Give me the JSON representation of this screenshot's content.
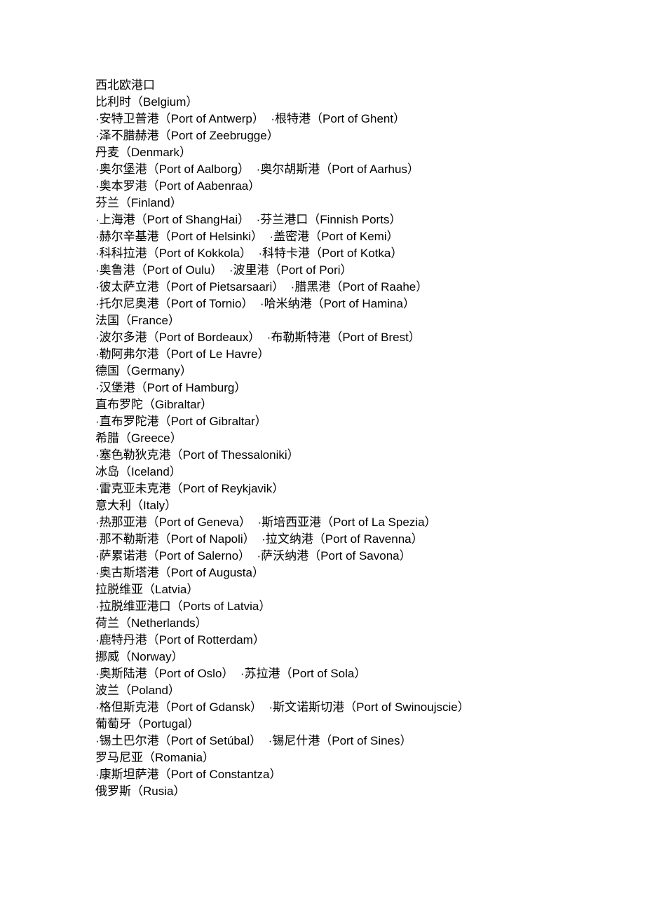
{
  "document": {
    "title": "西北欧港口",
    "lines": [
      {
        "kind": "heading",
        "text": "西北欧港口"
      },
      {
        "kind": "country",
        "text": "比利时（Belgium）"
      },
      {
        "kind": "ports",
        "text": "·安特卫普港（Port of Antwerp）  ·根特港（Port of Ghent）"
      },
      {
        "kind": "ports",
        "text": "·泽不腊赫港（Port of Zeebrugge）"
      },
      {
        "kind": "country",
        "text": "丹麦（Denmark）"
      },
      {
        "kind": "ports",
        "text": "·奥尔堡港（Port of Aalborg）  ·奥尔胡斯港（Port of Aarhus）"
      },
      {
        "kind": "ports",
        "text": "·奥本罗港（Port of Aabenraa）"
      },
      {
        "kind": "country",
        "text": "芬兰（Finland）"
      },
      {
        "kind": "ports",
        "text": "·上海港（Port of ShangHai）  ·芬兰港口（Finnish Ports）"
      },
      {
        "kind": "ports",
        "text": "·赫尔辛基港（Port of Helsinki）  ·盖密港（Port of Kemi）"
      },
      {
        "kind": "ports",
        "text": "·科科拉港（Port of Kokkola）  ·科特卡港（Port of Kotka）"
      },
      {
        "kind": "ports",
        "text": "·奥鲁港（Port of Oulu）  ·波里港（Port of Pori）"
      },
      {
        "kind": "ports",
        "text": "·彼太萨立港（Port of Pietsarsaari）  ·腊黑港（Port of Raahe）"
      },
      {
        "kind": "ports",
        "text": "·托尔尼奥港（Port of Tornio）  ·哈米纳港（Port of Hamina）"
      },
      {
        "kind": "country",
        "text": "法国（France）"
      },
      {
        "kind": "ports",
        "text": "·波尔多港（Port of Bordeaux）  ·布勒斯特港（Port of Brest）"
      },
      {
        "kind": "ports",
        "text": "·勒阿弗尔港（Port of Le Havre）"
      },
      {
        "kind": "country",
        "text": "德国（Germany）"
      },
      {
        "kind": "ports",
        "text": "·汉堡港（Port of Hamburg）"
      },
      {
        "kind": "country",
        "text": "直布罗陀（Gibraltar）"
      },
      {
        "kind": "ports",
        "text": "·直布罗陀港（Port of Gibraltar）"
      },
      {
        "kind": "country",
        "text": "希腊（Greece）"
      },
      {
        "kind": "ports",
        "text": "·塞色勒狄克港（Port of Thessaloniki）"
      },
      {
        "kind": "country",
        "text": "冰岛（Iceland）"
      },
      {
        "kind": "ports",
        "text": "·雷克亚未克港（Port of Reykjavik）"
      },
      {
        "kind": "country",
        "text": "意大利（Italy）"
      },
      {
        "kind": "ports",
        "text": "·热那亚港（Port of Geneva）  ·斯培西亚港（Port of La Spezia）"
      },
      {
        "kind": "ports",
        "text": "·那不勒斯港（Port of Napoli）  ·拉文纳港（Port of Ravenna）"
      },
      {
        "kind": "ports",
        "text": "·萨累诺港（Port of Salerno）  ·萨沃纳港（Port of Savona）"
      },
      {
        "kind": "ports",
        "text": "·奥古斯塔港（Port of Augusta）"
      },
      {
        "kind": "country",
        "text": "拉脱维亚（Latvia）"
      },
      {
        "kind": "ports",
        "text": "·拉脱维亚港口（Ports of Latvia）"
      },
      {
        "kind": "country",
        "text": "荷兰（Netherlands）"
      },
      {
        "kind": "ports",
        "text": "·鹿特丹港（Port of Rotterdam）"
      },
      {
        "kind": "country",
        "text": "挪威（Norway）"
      },
      {
        "kind": "ports",
        "text": "·奥斯陆港（Port of Oslo）  ·苏拉港（Port of Sola）"
      },
      {
        "kind": "country",
        "text": "波兰（Poland）"
      },
      {
        "kind": "ports",
        "text": "·格但斯克港（Port of Gdansk）  ·斯文诺斯切港（Port of Swinoujscie）"
      },
      {
        "kind": "country",
        "text": "葡萄牙（Portugal）"
      },
      {
        "kind": "ports",
        "text": "·锡土巴尔港（Port of Setúbal）  ·锡尼什港（Port of Sines）"
      },
      {
        "kind": "country",
        "text": "罗马尼亚（Romania）"
      },
      {
        "kind": "ports",
        "text": "·康斯坦萨港（Port of Constantza）"
      },
      {
        "kind": "country",
        "text": "俄罗斯（Rusia）"
      }
    ]
  },
  "style": {
    "text_color": "#000000",
    "page_background": "#ffffff"
  }
}
